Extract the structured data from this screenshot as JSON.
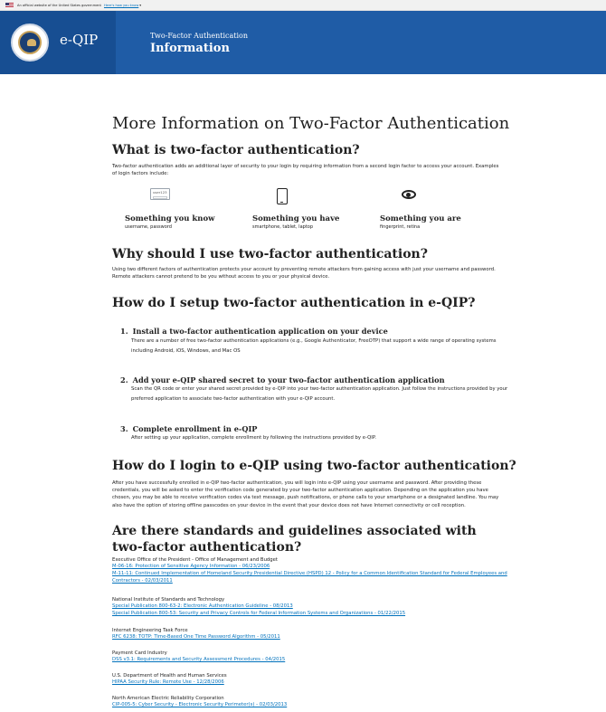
{
  "gov_banner": {
    "text": "An official website of the United States government",
    "link": "Here's how you know"
  },
  "header": {
    "brand": "e-QIP",
    "subtitle": "Two-Factor Authentication",
    "title": "Information",
    "colors": {
      "header_bg": "#1f5ca6",
      "left_panel_bg": "#174e92"
    }
  },
  "page_title": "More Information on Two-Factor Authentication",
  "what": {
    "heading": "What is two-factor authentication?",
    "text": "Two-factor authentication adds an additional layer of security to your login by requiring information from a second login factor to access your account. Examples of login factors include:",
    "factors": [
      {
        "icon": "password-field-icon",
        "icon_text": "user123",
        "label": "Something you know",
        "sub": "username, password"
      },
      {
        "icon": "smartphone-icon",
        "label": "Something you have",
        "sub": "smartphone, tablet, laptop"
      },
      {
        "icon": "eye-icon",
        "label": "Something you are",
        "sub": "fingerprint, retina"
      }
    ]
  },
  "why": {
    "heading": "Why should I use two-factor authentication?",
    "text": "Using two different factors of authentication protects your account by preventing remote attackers from gaining access with just your username and password. Remote attackers cannot pretend to be you without access to you or your physical device."
  },
  "setup": {
    "heading": "How do I setup two-factor authentication in e-QIP?",
    "steps": [
      {
        "num": "1.",
        "title": "Install a two-factor authentication application on your device",
        "text": "There are a number of free two-factor authentication applications (e.g., Google Authenticator, FreeOTP) that support a wide range of operating systems including Android, iOS, Windows, and Mac OS"
      },
      {
        "num": "2.",
        "title": "Add your e-QIP shared secret to your two-factor authentication application",
        "text": "Scan the QR code or enter your shared secret provided by e-QIP into your two-factor authentication application. Just follow the instructions provided by your preferred application to associate two-factor authentication with your e-QIP account."
      },
      {
        "num": "3.",
        "title": "Complete enrollment in e-QIP",
        "text": "After setting up your application, complete enrollment by following the instructions provided by e-QIP."
      }
    ]
  },
  "login": {
    "heading": "How do I login to e-QIP using two-factor authentication?",
    "text": "After you have successfully enrolled in e-QIP two-factor authentication, you will login into e-QIP using your username and password. After providing these credentials, you will be asked to enter the verification code generated by your two-factor authentication application. Depending on the application you have chosen, you may be able to receive verification codes via text message, push notifications, or phone calls to your smartphone or a designated landline. You may also have the option of storing offline passcodes on your device in the event that your device does not have Internet connectivity or cell reception."
  },
  "standards": {
    "heading": "Are there standards and guidelines associated with two-factor authentication?",
    "groups": [
      {
        "org": "Executive Office of the President - Office of Management and Budget",
        "links": [
          "M-06-16: Protection of Sensitive Agency Information - 06/23/2006",
          "M-11-11: Continued Implementation of Homeland Security Presidential Directive (HSPD) 12 - Policy for a Common Identification Standard for Federal Employees and Contractors - 02/03/2011"
        ]
      },
      {
        "org": "National Institute of Standards and Technology",
        "links": [
          "Special Publication 800-63-2: Electronic Authentication Guideline - 08/2013",
          "Special Publication 800-53: Security and Privacy Controls for Federal Information Systems and Organizations - 01/22/2015"
        ]
      },
      {
        "org": "Internet Engineering Task Force",
        "links": [
          "RFC 6238: TOTP: Time-Based One Time Password Algorithm - 05/2011"
        ]
      },
      {
        "org": "Payment Card Industry",
        "links": [
          "DSS v3.1: Requirements and Security Assessment Procedures - 04/2015"
        ]
      },
      {
        "org": "U.S. Department of Health and Human Services",
        "links": [
          "HIPAA Security Rule: Remote Use - 12/28/2006"
        ]
      },
      {
        "org": "North American Electric Reliability Corporation",
        "links": [
          "CIP-005-5: Cyber Security - Electronic Security Perimeter(s) - 02/03/2013"
        ]
      }
    ]
  }
}
